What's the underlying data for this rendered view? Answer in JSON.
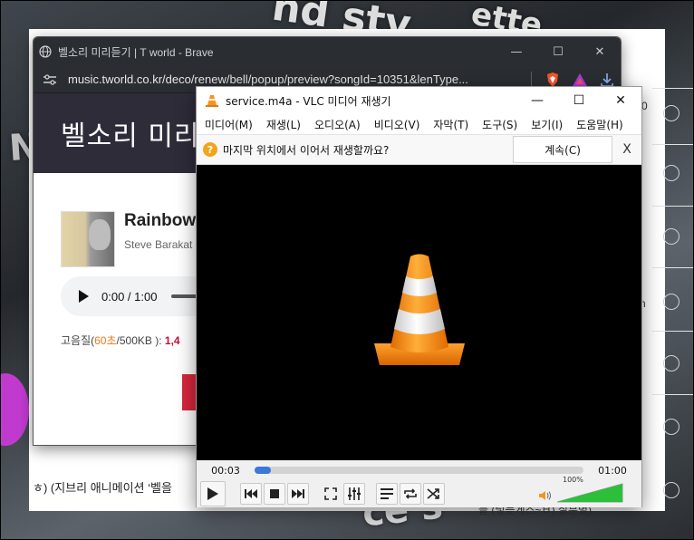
{
  "background": {
    "footer_left": "ㅎ) (지브리 애니메이션 ‘벨을",
    "footer_right": "늘 (렇늦게스~ㅂ) 질분별)",
    "side_digit": "0",
    "side_letter": "n",
    "stray_word": "nd sty",
    "stray_word2": "ette",
    "stray_word3": "ce s"
  },
  "brave": {
    "title": "벨소리 미리듣기 | T world - Brave",
    "url": "music.tworld.co.kr/deco/renew/bell/popup/preview?songId=10351&lenType...",
    "window_controls": {
      "minimize": "—",
      "maximize": "☐",
      "close": "✕"
    },
    "page_heading": "벨소리 미리",
    "song_title": "Rainbow",
    "artist": "Steve Barakat",
    "player_time": "0:00 / 1:00",
    "quality": {
      "prefix": "고음질(",
      "seconds": "60초",
      "suffix": "/500KB ): ",
      "price": "1,4"
    },
    "colors": {
      "titlebar": "#2a2d31",
      "header": "#2f2c3a",
      "accent_red": "#d7263d"
    }
  },
  "vlc": {
    "title": "service.m4a - VLC 미디어 재생기",
    "window_controls": {
      "minimize": "—",
      "maximize": "☐",
      "close": "✕"
    },
    "menu": [
      "미디어(M)",
      "재생(L)",
      "오디오(A)",
      "비디오(V)",
      "자막(T)",
      "도구(S)",
      "보기(I)",
      "도움말(H)"
    ],
    "notice": {
      "icon": "?",
      "message": "마지막 위치에서 이어서 재생할까요?",
      "continue_label": "계속(C)",
      "close": "X"
    },
    "time_elapsed": "00:03",
    "time_total": "01:00",
    "progress": 0.05,
    "volume_label": "100%",
    "volume": 1.0,
    "icons": [
      "play-icon",
      "previous-icon",
      "stop-icon",
      "next-icon",
      "fullscreen-icon",
      "equalizer-icon",
      "playlist-icon",
      "loop-icon",
      "shuffle-icon",
      "speaker-icon"
    ],
    "colors": {
      "cone_orange": "#f7941d",
      "seek_fill": "#3b78d8",
      "volume_green": "#2bbf3a"
    }
  }
}
